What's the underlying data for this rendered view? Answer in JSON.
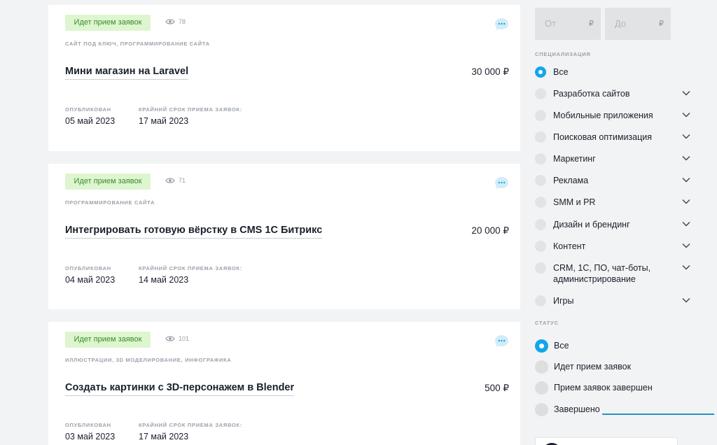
{
  "currency_symbol": "₽",
  "cards": [
    {
      "status": "Идет прием заявок",
      "views": "78",
      "categories": "Сайт под ключ, Программирование сайта",
      "title": "Мини магазин на Laravel",
      "price": "30 000 ₽",
      "published_label": "Опубликован",
      "published_date": "05 май 2023",
      "deadline_label": "Крайний срок приема заявок:",
      "deadline_date": "17 май 2023"
    },
    {
      "status": "Идет прием заявок",
      "views": "71",
      "categories": "Программирование сайта",
      "title": "Интегрировать готовую вёрстку в CMS 1С Битрикс",
      "price": "20 000 ₽",
      "published_label": "Опубликован",
      "published_date": "04 май 2023",
      "deadline_label": "Крайний срок приема заявок:",
      "deadline_date": "14 май 2023"
    },
    {
      "status": "Идет прием заявок",
      "views": "101",
      "categories": "Иллюстрации, 3D моделирование, инфографика",
      "title": "Создать картинки с 3D-персонажем в Blender",
      "price": "500 ₽",
      "published_label": "Опубликован",
      "published_date": "03 май 2023",
      "deadline_label": "Крайний срок приема заявок:",
      "deadline_date": "17 май 2023"
    }
  ],
  "sidebar": {
    "budget_from_placeholder": "От",
    "budget_to_placeholder": "До",
    "specialization_heading": "Специализация",
    "specializations": [
      "Все",
      "Разработка сайтов",
      "Мобильные приложения",
      "Поисковая оптимизация",
      "Маркетинг",
      "Реклама",
      "SMM и PR",
      "Дизайн и брендинг",
      "Контент",
      "CRM, 1С, ПО, чат-боты, администрирование",
      "Игры"
    ],
    "selected_specialization": "Все",
    "status_heading": "Статус",
    "statuses": [
      "Все",
      "Идет прием заявок",
      "Прием заявок завершен",
      "Завершено"
    ],
    "selected_status": "Все"
  },
  "colors": {
    "accent": "#12a6e8",
    "status_bg": "#ddf6cf",
    "status_text": "#3d8a2b"
  }
}
